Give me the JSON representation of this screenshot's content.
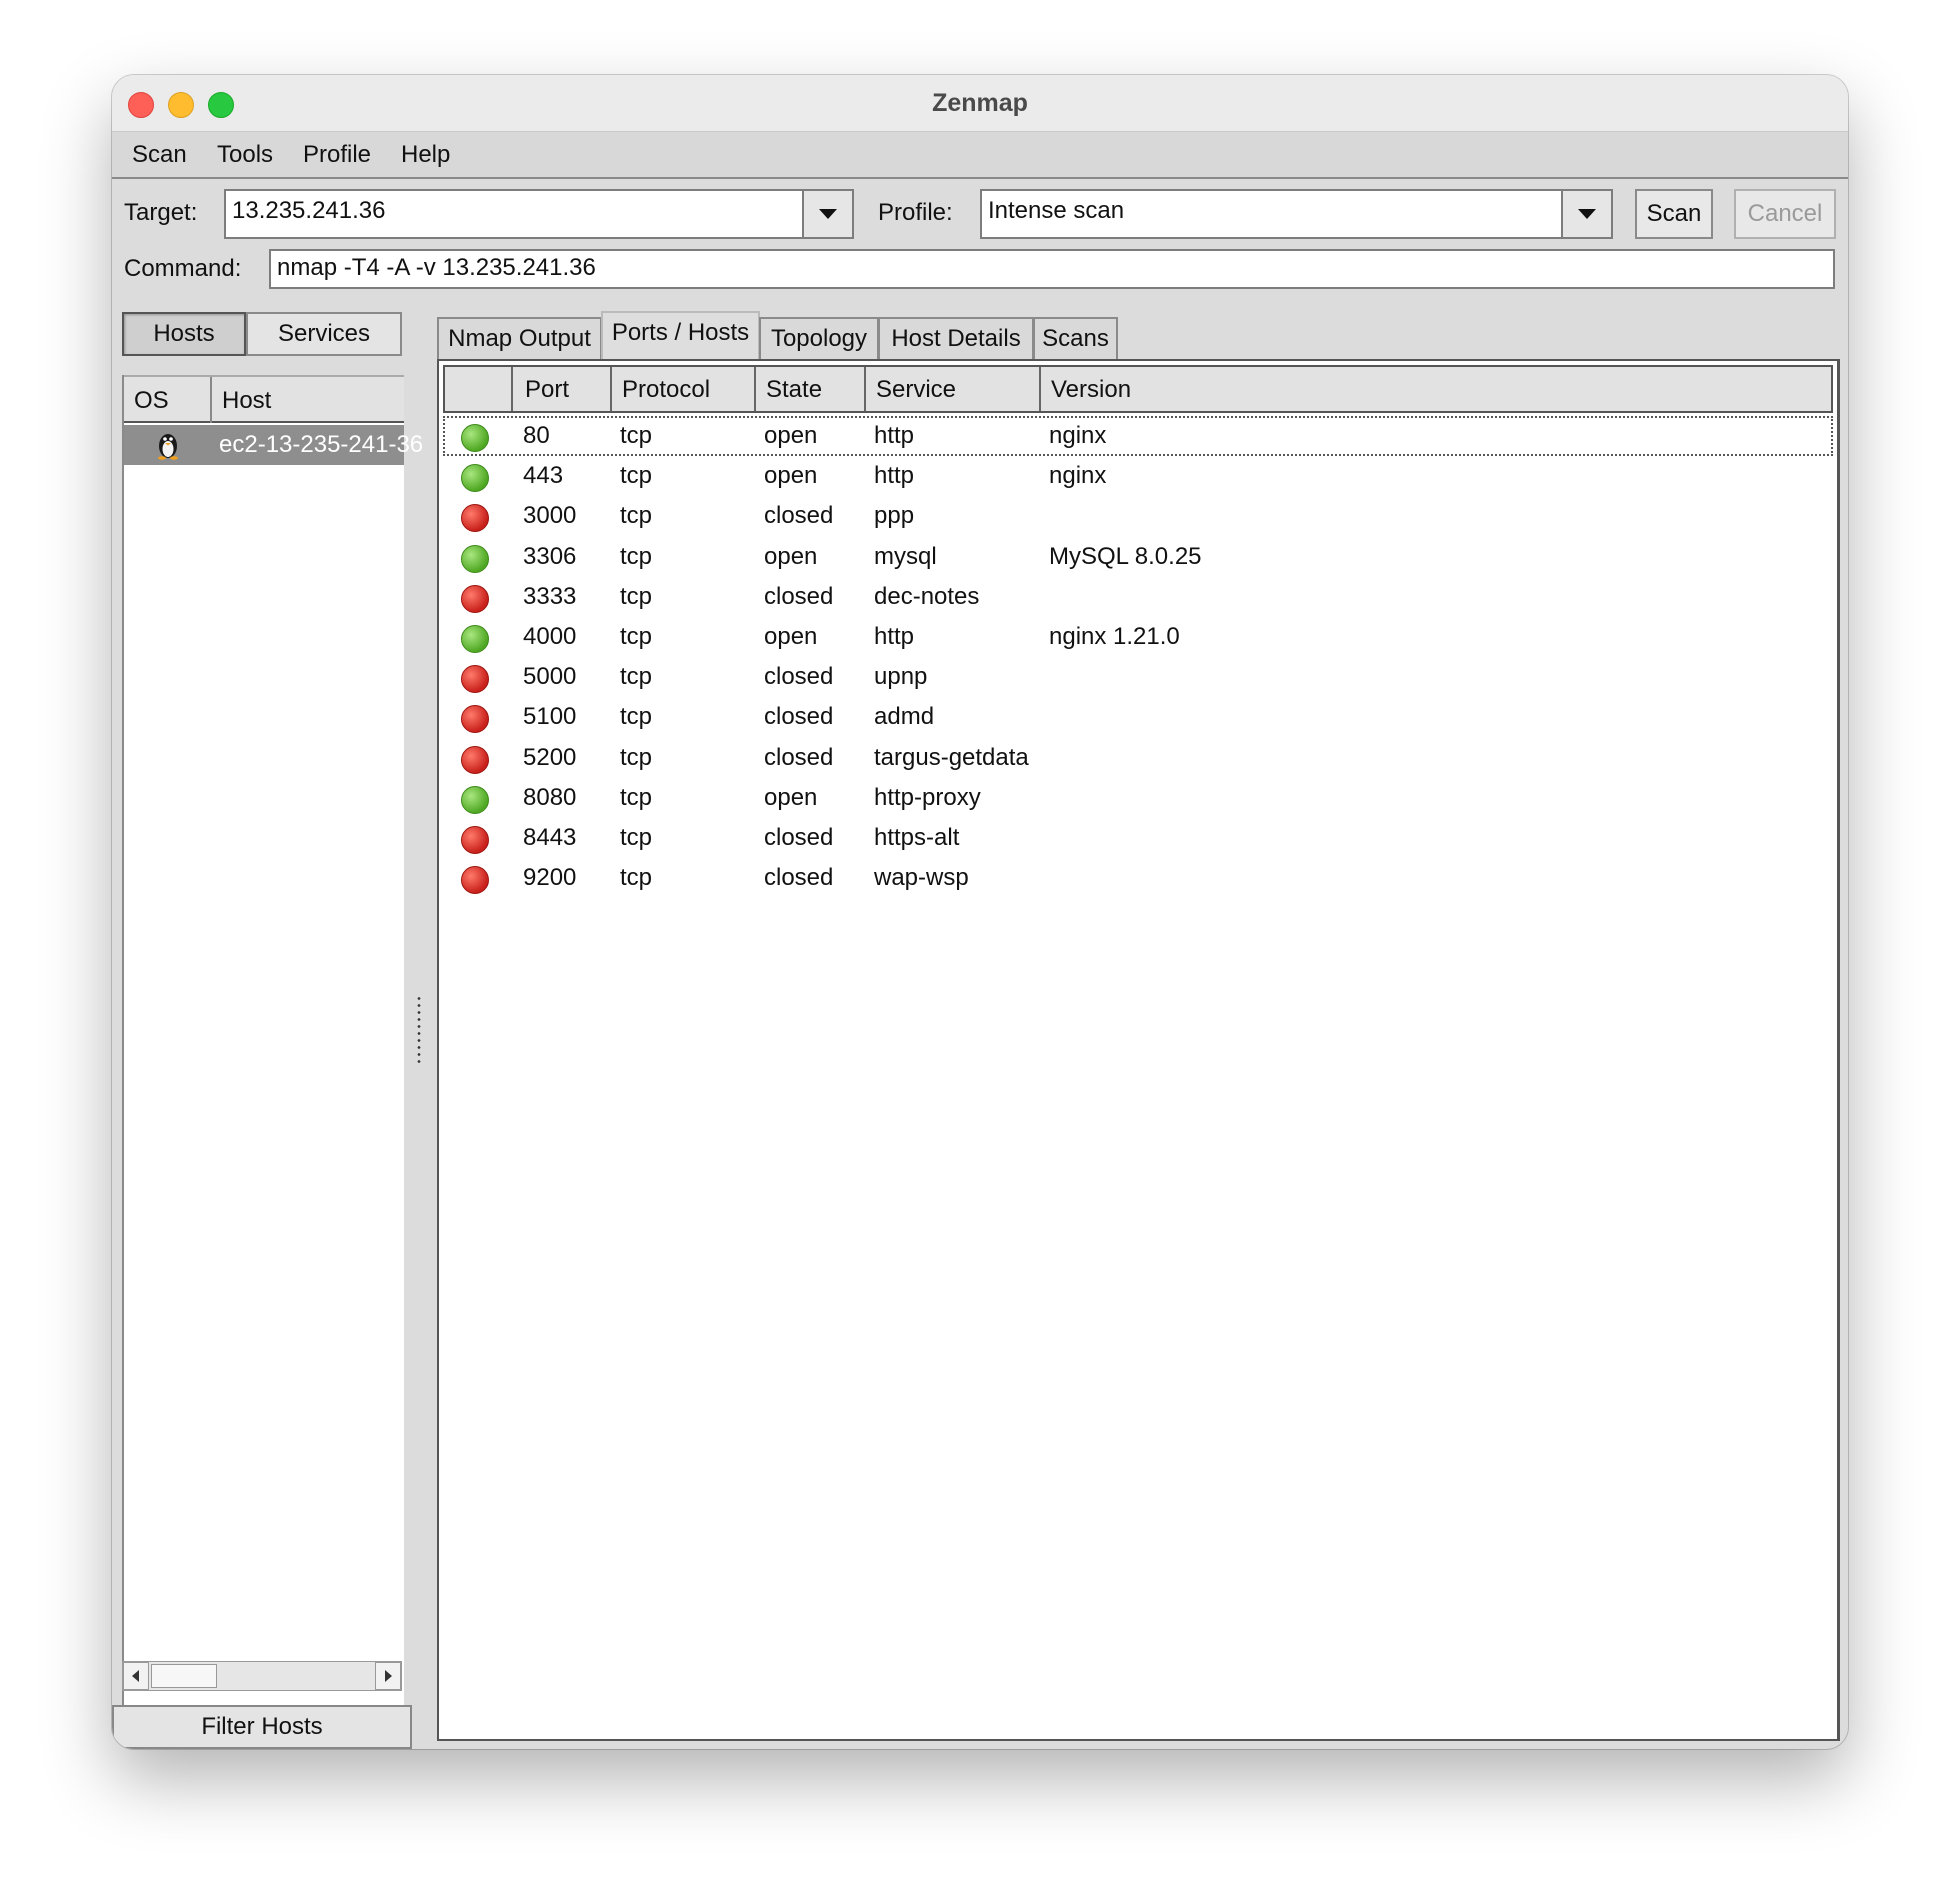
{
  "window": {
    "title": "Zenmap"
  },
  "menu": [
    "Scan",
    "Tools",
    "Profile",
    "Help"
  ],
  "toolbar": {
    "target_label": "Target:",
    "target_value": "13.235.241.36",
    "profile_label": "Profile:",
    "profile_value": "Intense scan",
    "scan_button": "Scan",
    "cancel_button": "Cancel",
    "command_label": "Command:",
    "command_value": "nmap -T4 -A -v 13.235.241.36"
  },
  "left_panel": {
    "hosts_tab": "Hosts",
    "services_tab": "Services",
    "col_os": "OS",
    "col_host": "Host",
    "hosts": [
      {
        "os_icon": "linux-penguin-icon",
        "name": "ec2-13-235-241-36"
      }
    ],
    "filter_button": "Filter Hosts"
  },
  "tabs": [
    "Nmap Output",
    "Ports / Hosts",
    "Topology",
    "Host Details",
    "Scans"
  ],
  "active_tab": "Ports / Hosts",
  "ports_table": {
    "columns": [
      "Port",
      "Protocol",
      "State",
      "Service",
      "Version"
    ],
    "rows": [
      {
        "port": "80",
        "protocol": "tcp",
        "state": "open",
        "service": "http",
        "version": "nginx"
      },
      {
        "port": "443",
        "protocol": "tcp",
        "state": "open",
        "service": "http",
        "version": "nginx"
      },
      {
        "port": "3000",
        "protocol": "tcp",
        "state": "closed",
        "service": "ppp",
        "version": ""
      },
      {
        "port": "3306",
        "protocol": "tcp",
        "state": "open",
        "service": "mysql",
        "version": "MySQL 8.0.25"
      },
      {
        "port": "3333",
        "protocol": "tcp",
        "state": "closed",
        "service": "dec-notes",
        "version": ""
      },
      {
        "port": "4000",
        "protocol": "tcp",
        "state": "open",
        "service": "http",
        "version": "nginx 1.21.0"
      },
      {
        "port": "5000",
        "protocol": "tcp",
        "state": "closed",
        "service": "upnp",
        "version": ""
      },
      {
        "port": "5100",
        "protocol": "tcp",
        "state": "closed",
        "service": "admd",
        "version": ""
      },
      {
        "port": "5200",
        "protocol": "tcp",
        "state": "closed",
        "service": "targus-getdata",
        "version": ""
      },
      {
        "port": "8080",
        "protocol": "tcp",
        "state": "open",
        "service": "http-proxy",
        "version": ""
      },
      {
        "port": "8443",
        "protocol": "tcp",
        "state": "closed",
        "service": "https-alt",
        "version": ""
      },
      {
        "port": "9200",
        "protocol": "tcp",
        "state": "closed",
        "service": "wap-wsp",
        "version": ""
      }
    ]
  },
  "colors": {
    "open": "#4fa823",
    "closed": "#c8201a",
    "selected_host_bg": "#8e8e8e"
  }
}
